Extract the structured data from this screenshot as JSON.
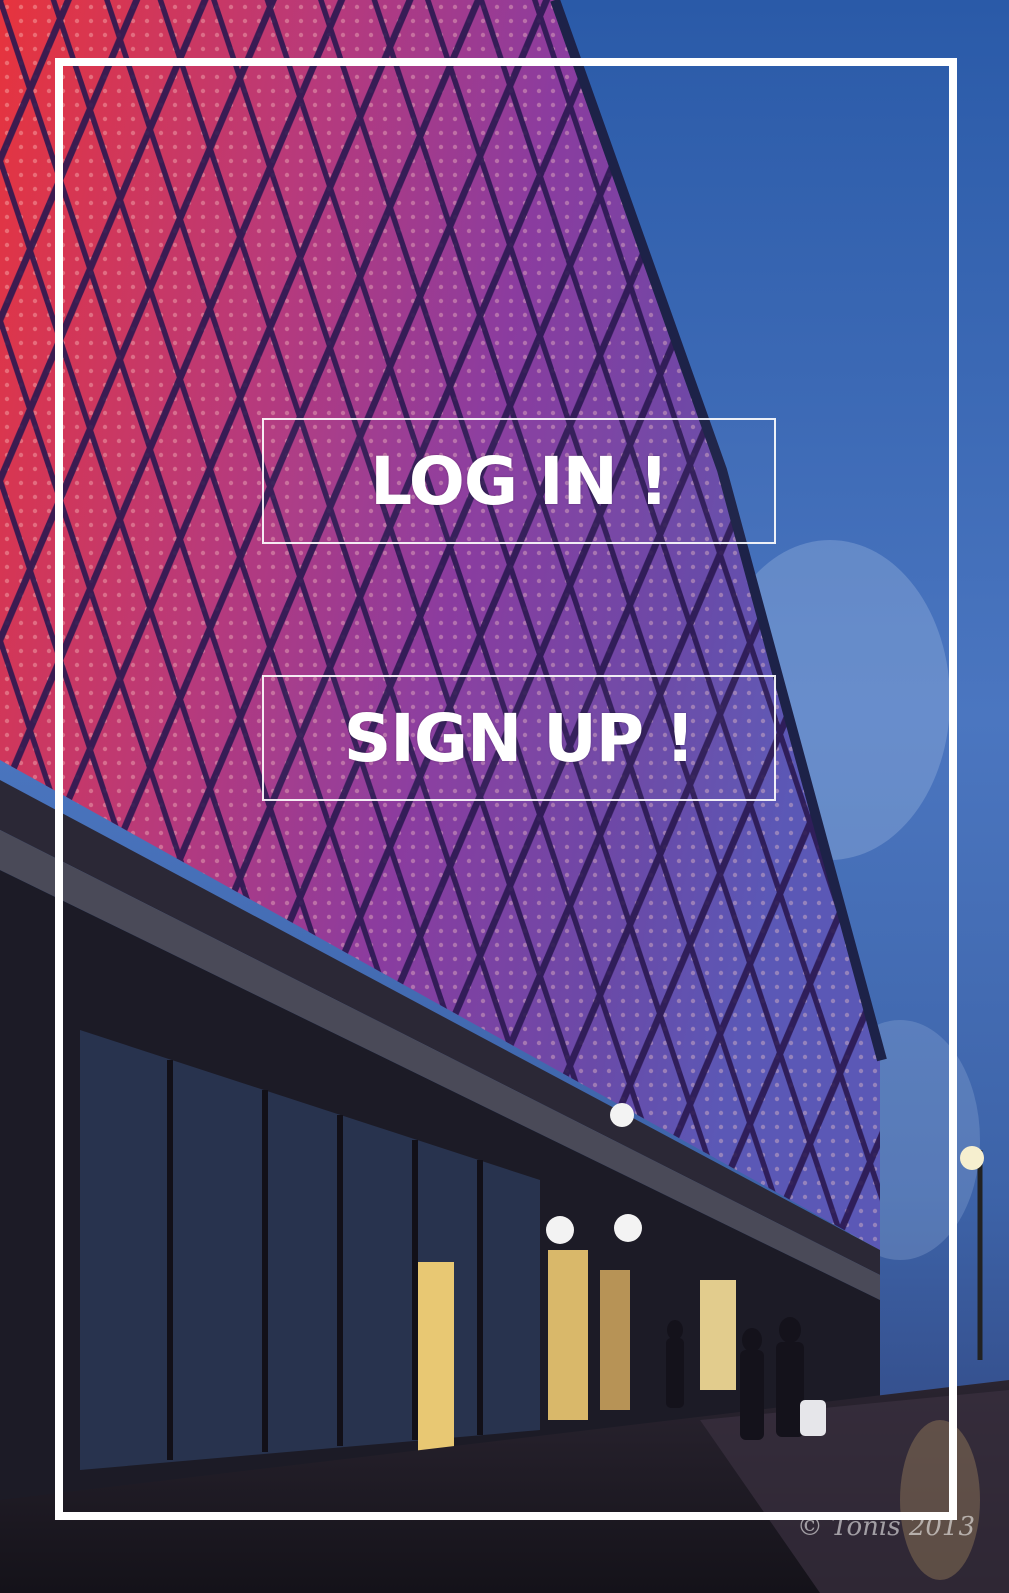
{
  "auth": {
    "login_label": "LOG IN !",
    "signup_label": "SIGN UP !"
  },
  "watermark": {
    "text": "© Tonis 2013"
  },
  "colors": {
    "frame": "#ffffff",
    "facade_red": "#e3394a",
    "facade_purple": "#7a3a9c",
    "sky": "#3e6ab8",
    "street": "#1b1a24"
  }
}
